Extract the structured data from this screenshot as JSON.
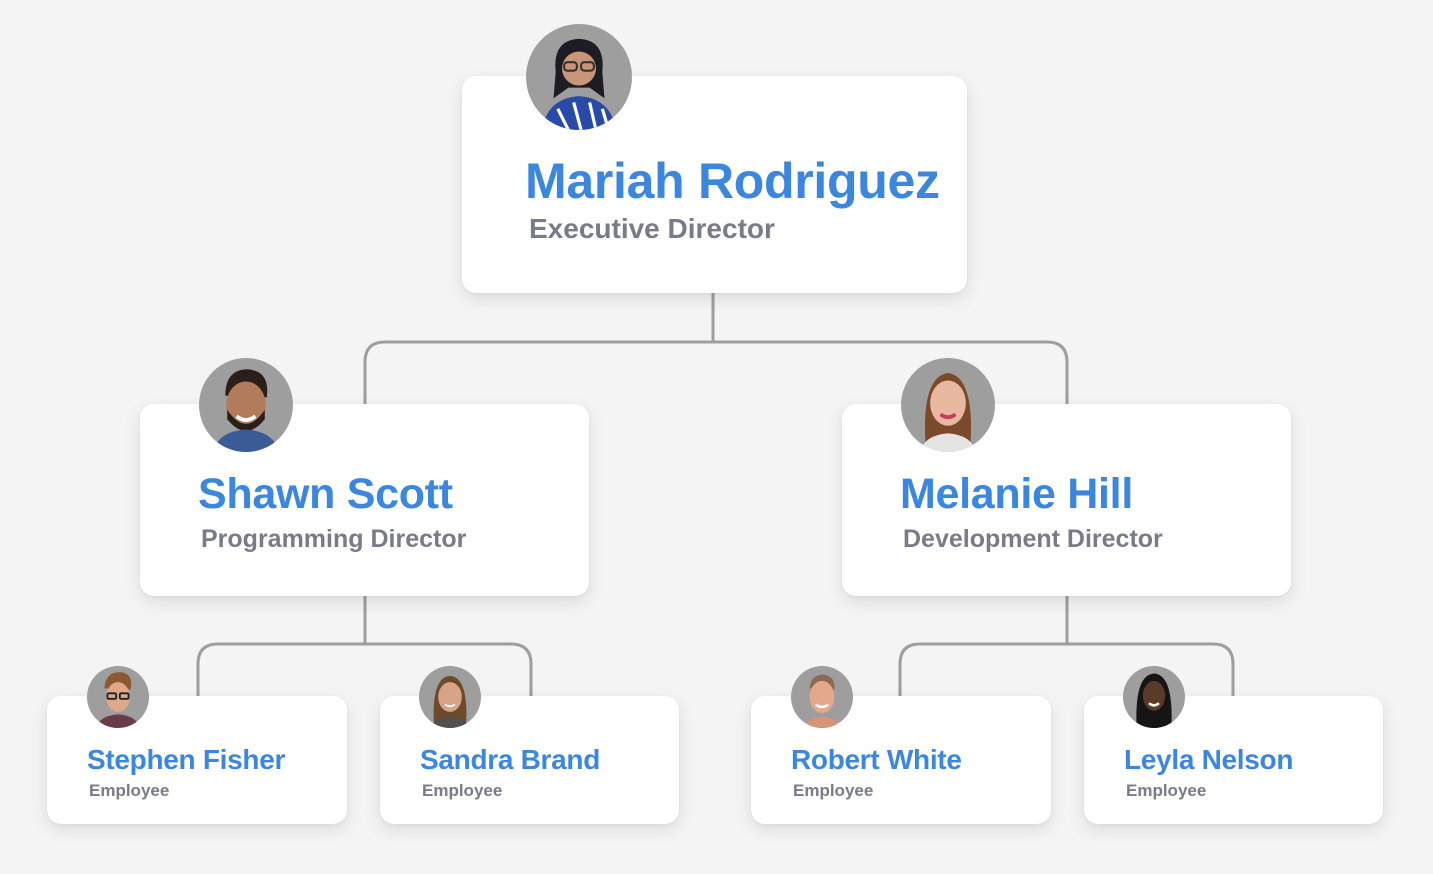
{
  "org_chart": {
    "root": {
      "name": "Mariah Rodriguez",
      "role": "Executive Director",
      "avatar_icon": "person-photo-icon"
    },
    "directors": [
      {
        "name": "Shawn Scott",
        "role": "Programming Director",
        "avatar_icon": "person-photo-icon",
        "reports": [
          {
            "name": "Stephen Fisher",
            "role": "Employee",
            "avatar_icon": "person-photo-icon"
          },
          {
            "name": "Sandra Brand",
            "role": "Employee",
            "avatar_icon": "person-photo-icon"
          }
        ]
      },
      {
        "name": "Melanie Hill",
        "role": "Development Director",
        "avatar_icon": "person-photo-icon",
        "reports": [
          {
            "name": "Robert White",
            "role": "Employee",
            "avatar_icon": "person-photo-icon"
          },
          {
            "name": "Leyla Nelson",
            "role": "Employee",
            "avatar_icon": "person-photo-icon"
          }
        ]
      }
    ]
  },
  "colors": {
    "name": "#3b87e0",
    "role": "#7a7a88",
    "connector": "#9e9e9e",
    "background": "#f4f4f4",
    "card": "#ffffff"
  }
}
